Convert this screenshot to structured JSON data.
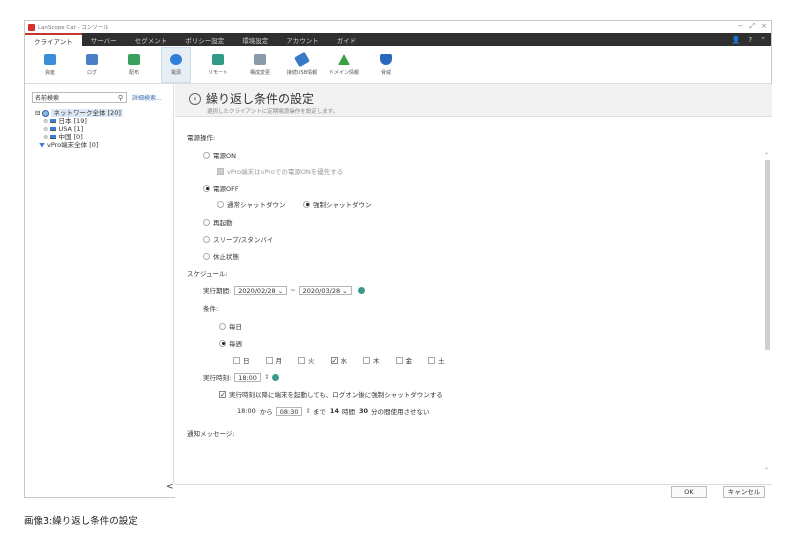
{
  "window": {
    "title": "LanScope Cat - コンソール",
    "controls": [
      "−",
      "⤢",
      "×"
    ]
  },
  "nav": {
    "tabs": [
      "クライアント",
      "サーバー",
      "セグメント",
      "ポリシー設定",
      "環境設定",
      "アカウント",
      "ガイド"
    ],
    "right": [
      "👤",
      "?",
      "⌃"
    ]
  },
  "ribbon": {
    "items": [
      {
        "label": "資産",
        "color": "#3a8fd8"
      },
      {
        "label": "ログ",
        "color": "#4a7fc8"
      },
      {
        "label": "配布",
        "color": "#3aa060"
      },
      {
        "label": "電源",
        "color": "#2f7fd8"
      },
      {
        "label": "リモート",
        "color": "#2f9a88"
      },
      {
        "label": "構成変更",
        "color": "#8a9aa8"
      },
      {
        "label": "接続USB情報",
        "color": "#3a78c8"
      },
      {
        "label": "ドメイン情報",
        "color": "#3aa040"
      },
      {
        "label": "脅威",
        "color": "#2a68c0"
      }
    ]
  },
  "left": {
    "search_placeholder": "名前検索",
    "advanced_link": "詳細検索...",
    "tree": [
      {
        "label": "ネットワーク全体 [20]",
        "level": 0
      },
      {
        "label": "日本 [19]",
        "level": 1
      },
      {
        "label": "USA [1]",
        "level": 1
      },
      {
        "label": "中国 [0]",
        "level": 1
      },
      {
        "label": "vPro端末全体 [0]",
        "level": 0
      }
    ],
    "collapse": "<"
  },
  "main": {
    "title": "繰り返し条件の設定",
    "subtitle": "選択したクライアントに定期電源操作を設定します。",
    "power_label": "電源操作:",
    "power_on": "電源ON",
    "vpro_option": "vPro端末はvProでの電源ONを優先する",
    "power_off": "電源OFF",
    "normal_shutdown": "通常シャットダウン",
    "force_shutdown": "強制シャットダウン",
    "restart": "再起動",
    "sleep": "スリープ/スタンバイ",
    "hibernate": "休止状態",
    "schedule_label": "スケジュール:",
    "period_label": "実行期間:",
    "date_from": "2020/02/28 ⌄",
    "tilde": "~",
    "date_to": "2020/03/28 ⌄",
    "condition_label": "条件:",
    "daily": "毎日",
    "weekly": "毎週",
    "days": [
      {
        "label": "日",
        "checked": false
      },
      {
        "label": "月",
        "checked": false
      },
      {
        "label": "火",
        "checked": false
      },
      {
        "label": "水",
        "checked": true
      },
      {
        "label": "木",
        "checked": false
      },
      {
        "label": "金",
        "checked": false
      },
      {
        "label": "土",
        "checked": false
      }
    ],
    "time_label": "実行時刻:",
    "time_value": "18:00",
    "force_after": "実行時刻以降に端末を起動しても、ログオン後に強制シャットダウンする",
    "range_from": "18:00",
    "range_kara": "から",
    "range_to": "08:30",
    "range_made": "まで",
    "hours": "14",
    "hours_unit": "時間",
    "minutes": "30",
    "minutes_unit": "分の間使用させない",
    "notify_label": "通知メッセージ:"
  },
  "footer": {
    "ok": "OK",
    "cancel": "キャンセル"
  },
  "caption": "画像3:繰り返し条件の設定"
}
